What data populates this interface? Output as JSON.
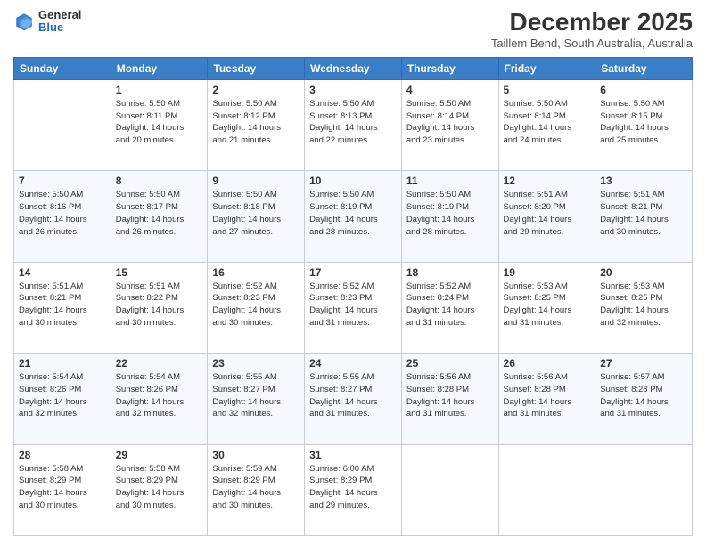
{
  "logo": {
    "general": "General",
    "blue": "Blue"
  },
  "header": {
    "month_year": "December 2025",
    "location": "Taillem Bend, South Australia, Australia"
  },
  "days_of_week": [
    "Sunday",
    "Monday",
    "Tuesday",
    "Wednesday",
    "Thursday",
    "Friday",
    "Saturday"
  ],
  "weeks": [
    [
      {
        "day": "",
        "info": ""
      },
      {
        "day": "1",
        "info": "Sunrise: 5:50 AM\nSunset: 8:11 PM\nDaylight: 14 hours\nand 20 minutes."
      },
      {
        "day": "2",
        "info": "Sunrise: 5:50 AM\nSunset: 8:12 PM\nDaylight: 14 hours\nand 21 minutes."
      },
      {
        "day": "3",
        "info": "Sunrise: 5:50 AM\nSunset: 8:13 PM\nDaylight: 14 hours\nand 22 minutes."
      },
      {
        "day": "4",
        "info": "Sunrise: 5:50 AM\nSunset: 8:14 PM\nDaylight: 14 hours\nand 23 minutes."
      },
      {
        "day": "5",
        "info": "Sunrise: 5:50 AM\nSunset: 8:14 PM\nDaylight: 14 hours\nand 24 minutes."
      },
      {
        "day": "6",
        "info": "Sunrise: 5:50 AM\nSunset: 8:15 PM\nDaylight: 14 hours\nand 25 minutes."
      }
    ],
    [
      {
        "day": "7",
        "info": "Sunrise: 5:50 AM\nSunset: 8:16 PM\nDaylight: 14 hours\nand 26 minutes."
      },
      {
        "day": "8",
        "info": "Sunrise: 5:50 AM\nSunset: 8:17 PM\nDaylight: 14 hours\nand 26 minutes."
      },
      {
        "day": "9",
        "info": "Sunrise: 5:50 AM\nSunset: 8:18 PM\nDaylight: 14 hours\nand 27 minutes."
      },
      {
        "day": "10",
        "info": "Sunrise: 5:50 AM\nSunset: 8:19 PM\nDaylight: 14 hours\nand 28 minutes."
      },
      {
        "day": "11",
        "info": "Sunrise: 5:50 AM\nSunset: 8:19 PM\nDaylight: 14 hours\nand 28 minutes."
      },
      {
        "day": "12",
        "info": "Sunrise: 5:51 AM\nSunset: 8:20 PM\nDaylight: 14 hours\nand 29 minutes."
      },
      {
        "day": "13",
        "info": "Sunrise: 5:51 AM\nSunset: 8:21 PM\nDaylight: 14 hours\nand 30 minutes."
      }
    ],
    [
      {
        "day": "14",
        "info": "Sunrise: 5:51 AM\nSunset: 8:21 PM\nDaylight: 14 hours\nand 30 minutes."
      },
      {
        "day": "15",
        "info": "Sunrise: 5:51 AM\nSunset: 8:22 PM\nDaylight: 14 hours\nand 30 minutes."
      },
      {
        "day": "16",
        "info": "Sunrise: 5:52 AM\nSunset: 8:23 PM\nDaylight: 14 hours\nand 30 minutes."
      },
      {
        "day": "17",
        "info": "Sunrise: 5:52 AM\nSunset: 8:23 PM\nDaylight: 14 hours\nand 31 minutes."
      },
      {
        "day": "18",
        "info": "Sunrise: 5:52 AM\nSunset: 8:24 PM\nDaylight: 14 hours\nand 31 minutes."
      },
      {
        "day": "19",
        "info": "Sunrise: 5:53 AM\nSunset: 8:25 PM\nDaylight: 14 hours\nand 31 minutes."
      },
      {
        "day": "20",
        "info": "Sunrise: 5:53 AM\nSunset: 8:25 PM\nDaylight: 14 hours\nand 32 minutes."
      }
    ],
    [
      {
        "day": "21",
        "info": "Sunrise: 5:54 AM\nSunset: 8:26 PM\nDaylight: 14 hours\nand 32 minutes."
      },
      {
        "day": "22",
        "info": "Sunrise: 5:54 AM\nSunset: 8:26 PM\nDaylight: 14 hours\nand 32 minutes."
      },
      {
        "day": "23",
        "info": "Sunrise: 5:55 AM\nSunset: 8:27 PM\nDaylight: 14 hours\nand 32 minutes."
      },
      {
        "day": "24",
        "info": "Sunrise: 5:55 AM\nSunset: 8:27 PM\nDaylight: 14 hours\nand 31 minutes."
      },
      {
        "day": "25",
        "info": "Sunrise: 5:56 AM\nSunset: 8:28 PM\nDaylight: 14 hours\nand 31 minutes."
      },
      {
        "day": "26",
        "info": "Sunrise: 5:56 AM\nSunset: 8:28 PM\nDaylight: 14 hours\nand 31 minutes."
      },
      {
        "day": "27",
        "info": "Sunrise: 5:57 AM\nSunset: 8:28 PM\nDaylight: 14 hours\nand 31 minutes."
      }
    ],
    [
      {
        "day": "28",
        "info": "Sunrise: 5:58 AM\nSunset: 8:29 PM\nDaylight: 14 hours\nand 30 minutes."
      },
      {
        "day": "29",
        "info": "Sunrise: 5:58 AM\nSunset: 8:29 PM\nDaylight: 14 hours\nand 30 minutes."
      },
      {
        "day": "30",
        "info": "Sunrise: 5:59 AM\nSunset: 8:29 PM\nDaylight: 14 hours\nand 30 minutes."
      },
      {
        "day": "31",
        "info": "Sunrise: 6:00 AM\nSunset: 8:29 PM\nDaylight: 14 hours\nand 29 minutes."
      },
      {
        "day": "",
        "info": ""
      },
      {
        "day": "",
        "info": ""
      },
      {
        "day": "",
        "info": ""
      }
    ]
  ]
}
